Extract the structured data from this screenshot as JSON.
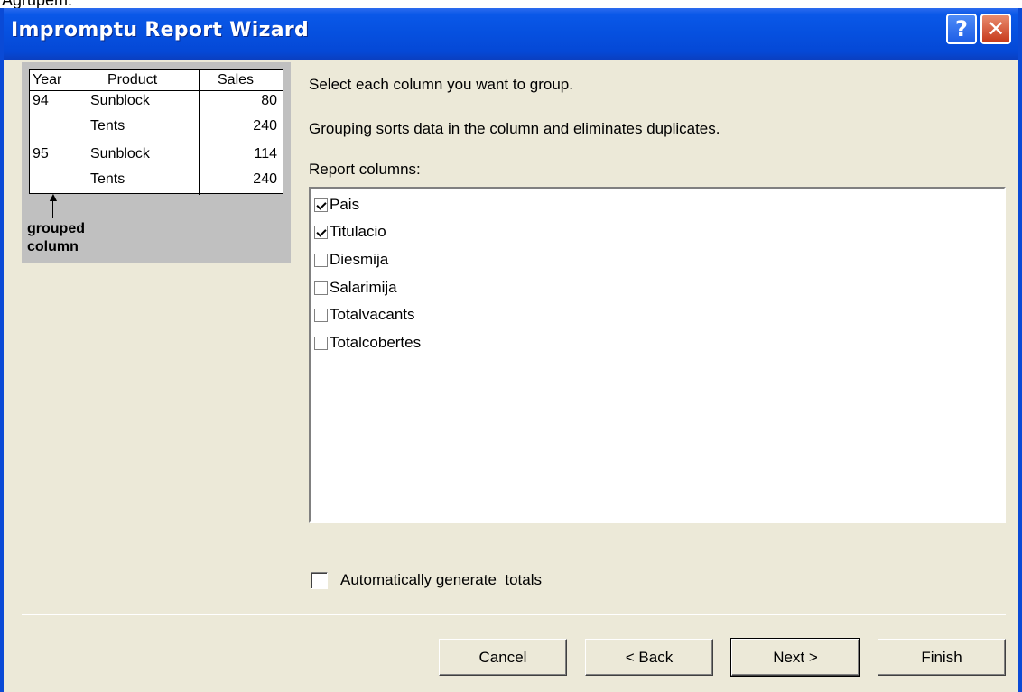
{
  "caption": "Agrupem:",
  "window": {
    "title": "Impromptu Report Wizard",
    "help_label": "?",
    "close_label": "✕"
  },
  "preview": {
    "headers": [
      "Year",
      "Product",
      "Sales"
    ],
    "rows": [
      {
        "year": "94",
        "product": "Sunblock",
        "sales": "80"
      },
      {
        "year": "",
        "product": "Tents",
        "sales": "240"
      },
      {
        "year": "95",
        "product": "Sunblock",
        "sales": "114"
      },
      {
        "year": "",
        "product": "Tents",
        "sales": "240"
      }
    ],
    "annotation": [
      "grouped",
      "column"
    ]
  },
  "instructions": {
    "line1": "Select each column you want to group.",
    "line2": "Grouping sorts data in the column and eliminates duplicates.",
    "list_label": "Report columns:"
  },
  "columns": [
    {
      "label": "Pais",
      "checked": true
    },
    {
      "label": "Titulacio",
      "checked": true
    },
    {
      "label": "Diesmija",
      "checked": false
    },
    {
      "label": "Salarimija",
      "checked": false
    },
    {
      "label": "Totalvacants",
      "checked": false
    },
    {
      "label": "Totalcobertes",
      "checked": false
    }
  ],
  "auto_totals": {
    "label": "Automatically generate  totals",
    "checked": false
  },
  "buttons": {
    "cancel": "Cancel",
    "back": "< Back",
    "next": "Next >",
    "finish": "Finish"
  }
}
